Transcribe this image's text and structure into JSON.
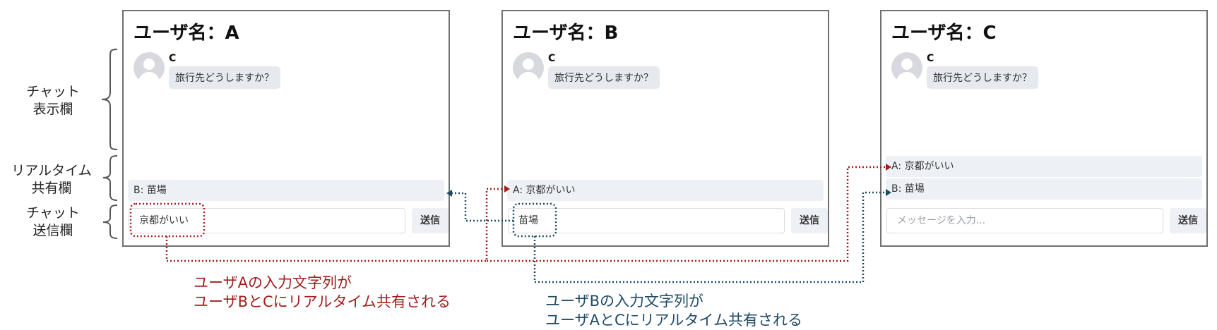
{
  "side_labels": {
    "chat_display": [
      "チャット",
      "表示欄"
    ],
    "realtime_share": [
      "リアルタイム",
      "共有欄"
    ],
    "chat_send": [
      "チャット",
      "送信欄"
    ]
  },
  "panels": [
    {
      "title": "ユーザ名：A",
      "sender": "C",
      "message": "旅行先どうしますか？",
      "shared": [
        "B: 苗場"
      ],
      "input_value": "京都がいい",
      "input_placeholder": "",
      "send_label": "送信"
    },
    {
      "title": "ユーザ名：B",
      "sender": "C",
      "message": "旅行先どうしますか？",
      "shared": [
        "A: 京都がいい"
      ],
      "input_value": "苗場",
      "input_placeholder": "",
      "send_label": "送信"
    },
    {
      "title": "ユーザ名：C",
      "sender": "C",
      "message": "旅行先どうしますか？",
      "shared": [
        "A: 京都がいい",
        "B: 苗場"
      ],
      "input_value": "",
      "input_placeholder": "メッセージを入力...",
      "send_label": "送信"
    }
  ],
  "captions": {
    "user_a": [
      "ユーザAの入力文字列が",
      "ユーザBとCにリアルタイム共有される"
    ],
    "user_b": [
      "ユーザBの入力文字列が",
      "ユーザAとCにリアルタイム共有される"
    ]
  },
  "colors": {
    "user_a_line": "#a31d1d",
    "user_b_line": "#1d4a63"
  }
}
